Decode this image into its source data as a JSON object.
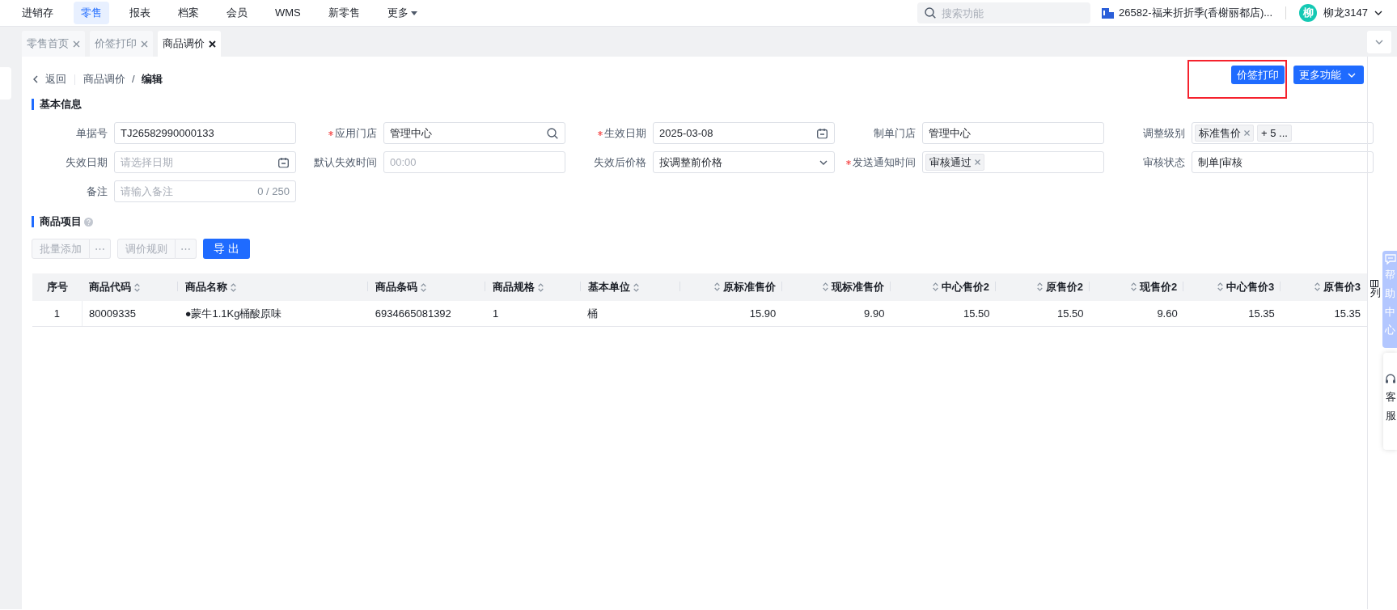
{
  "top_nav": {
    "items": [
      {
        "label": "进销存",
        "selected": false,
        "dropdown": false
      },
      {
        "label": "零售",
        "selected": true,
        "dropdown": false
      },
      {
        "label": "报表",
        "selected": false,
        "dropdown": false
      },
      {
        "label": "档案",
        "selected": false,
        "dropdown": false
      },
      {
        "label": "会员",
        "selected": false,
        "dropdown": false
      },
      {
        "label": "WMS",
        "selected": false,
        "dropdown": false
      },
      {
        "label": "新零售",
        "selected": false,
        "dropdown": false
      },
      {
        "label": "更多",
        "selected": false,
        "dropdown": true
      }
    ],
    "search": {
      "placeholder": "搜索功能"
    },
    "store": "26582-福来折折季(香榭丽都店)...",
    "user": {
      "avatar": "柳",
      "name": "柳龙3147"
    }
  },
  "tabs": [
    {
      "label": "零售首页",
      "selected": false
    },
    {
      "label": "价签打印",
      "selected": false
    },
    {
      "label": "商品调价",
      "selected": true
    }
  ],
  "breadcrumb": {
    "back": "返回",
    "path": [
      "商品调价"
    ],
    "separator": "/",
    "current": "编辑"
  },
  "actions": [
    {
      "label": "价签打印",
      "highlighted": true,
      "dropdown": false
    },
    {
      "label": "更多功能",
      "dropdown": true
    }
  ],
  "basic_info": {
    "title": "基本信息",
    "fields": [
      {
        "label": "单据号",
        "required": false,
        "kind": "text",
        "value": "TJ26582990000133"
      },
      {
        "label": "应用门店",
        "required": true,
        "kind": "search",
        "value": "管理中心"
      },
      {
        "label": "生效日期",
        "required": true,
        "kind": "date",
        "value": "2025-03-08"
      },
      {
        "label": "制单门店",
        "required": false,
        "kind": "text",
        "value": "管理中心"
      },
      {
        "label": "调整级别",
        "required": false,
        "kind": "tags",
        "tags": [
          {
            "text": "标准售价",
            "removable": true
          },
          {
            "text": "+ 5 ...",
            "removable": false
          }
        ]
      },
      {
        "label": "失效日期",
        "required": false,
        "kind": "date",
        "placeholder": "请选择日期"
      },
      {
        "label": "默认失效时间",
        "required": false,
        "kind": "text",
        "placeholder": "00:00"
      },
      {
        "label": "失效后价格",
        "required": false,
        "kind": "select",
        "value": "按调整前价格"
      },
      {
        "label": "发送通知时间",
        "required": true,
        "kind": "tags",
        "tags": [
          {
            "text": "审核通过",
            "removable": true
          }
        ]
      },
      {
        "label": "审核状态",
        "required": false,
        "kind": "text",
        "value": "制单|审核"
      },
      {
        "label": "备注",
        "required": false,
        "kind": "text",
        "placeholder": "请输入备注",
        "counter": "0 / 250"
      }
    ]
  },
  "items": {
    "title": "商品项目",
    "help": true,
    "buttons": [
      {
        "label": "批量添加",
        "disabled": true,
        "more": "⋯",
        "primary": false
      },
      {
        "label": "调价规则",
        "disabled": true,
        "more": "⋯",
        "primary": false
      },
      {
        "label": "导 出",
        "disabled": false,
        "primary": true
      }
    ],
    "table": {
      "columns": [
        {
          "label": "序号",
          "sortable": false
        },
        {
          "label": "商品代码",
          "sortable": true
        },
        {
          "label": "商品名称",
          "sortable": true
        },
        {
          "label": "商品条码",
          "sortable": true
        },
        {
          "label": "商品规格",
          "sortable": true
        },
        {
          "label": "基本单位",
          "sortable": true
        },
        {
          "label": "原标准售价",
          "sortable": true
        },
        {
          "label": "现标准售价",
          "sortable": true
        },
        {
          "label": "中心售价2",
          "sortable": true
        },
        {
          "label": "原售价2",
          "sortable": true
        },
        {
          "label": "现售价2",
          "sortable": true
        },
        {
          "label": "中心售价3",
          "sortable": true
        },
        {
          "label": "原售价3",
          "sortable": true
        }
      ],
      "rows": [
        [
          "1",
          "80009335",
          "●蒙牛1.1Kg桶酸原味",
          "6934665081392",
          "1",
          "桶",
          "15.90",
          "9.90",
          "15.50",
          "15.50",
          "9.60",
          "15.35",
          "15.35"
        ]
      ]
    }
  },
  "right_rail": {
    "columns_setting": "列",
    "help": "帮助中心",
    "service": "客服"
  }
}
